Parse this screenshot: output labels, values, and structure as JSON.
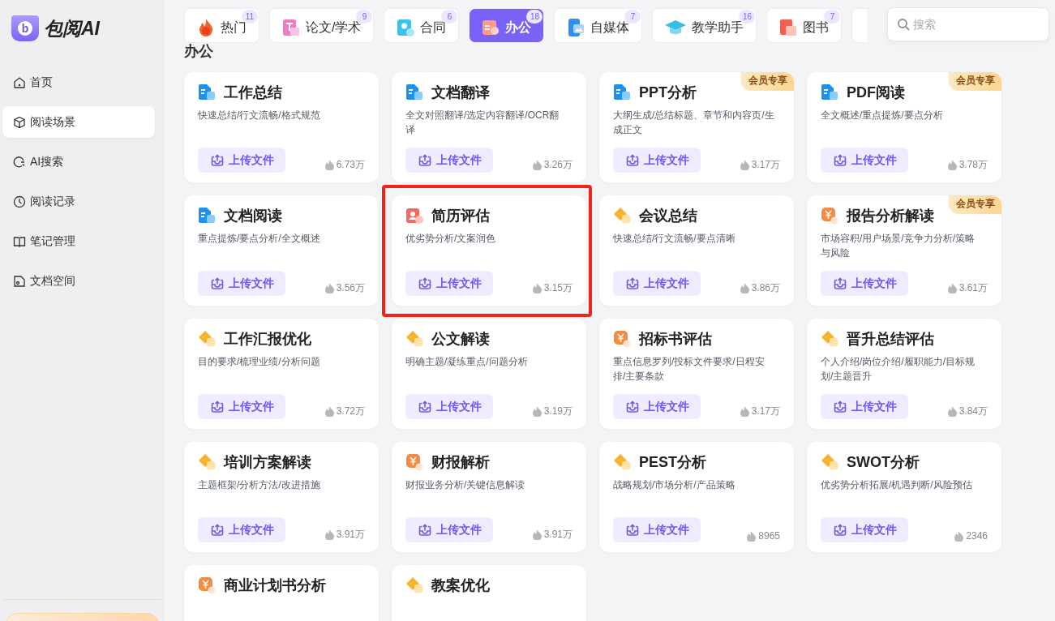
{
  "logo": {
    "mark": "b",
    "text": "包阅AI"
  },
  "sidebar": {
    "items": [
      {
        "label": "首页",
        "kind": "home",
        "selected": false
      },
      {
        "label": "阅读场景",
        "kind": "cube",
        "selected": true
      },
      {
        "label": "AI搜索",
        "kind": "search",
        "selected": false
      },
      {
        "label": "阅读记录",
        "kind": "clock",
        "selected": false
      },
      {
        "label": "笔记管理",
        "kind": "book",
        "selected": false
      },
      {
        "label": "文档空间",
        "kind": "file",
        "selected": false
      }
    ]
  },
  "tabs": [
    {
      "label": "热门",
      "kind": "fire",
      "badge": "11",
      "selected": false
    },
    {
      "label": "论文/学术",
      "kind": "paper",
      "badge": "9",
      "selected": false
    },
    {
      "label": "合同",
      "kind": "contract",
      "badge": "6",
      "selected": false
    },
    {
      "label": "办公",
      "kind": "office",
      "badge": "18",
      "selected": true
    },
    {
      "label": "自媒体",
      "kind": "media",
      "badge": "7",
      "selected": false
    },
    {
      "label": "教学助手",
      "kind": "cap",
      "badge": "16",
      "selected": false
    },
    {
      "label": "图书",
      "kind": "books",
      "badge": "7",
      "selected": false
    }
  ],
  "more_tab_visible": true,
  "search": {
    "placeholder": "搜索"
  },
  "section_title": "办公",
  "cards": [
    {
      "title": "工作总结",
      "kind": "doc",
      "description": "快速总结/行文流畅/格式规范",
      "action": "上传文件",
      "count": "6.73万",
      "highlighted": false
    },
    {
      "title": "文档翻译",
      "kind": "doc",
      "description": "全文对照翻译/选定内容翻译/OCR翻译",
      "action": "上传文件",
      "count": "3.26万",
      "highlighted": false
    },
    {
      "title": "PPT分析",
      "kind": "doc",
      "description": "大纲生成/总结标题、章节和内容页/生成正文",
      "action": "上传文件",
      "count": "3.17万",
      "member_badge": "会员专享",
      "highlighted": false
    },
    {
      "title": "PDF阅读",
      "kind": "doc",
      "description": "全文概述/重点提炼/要点分析",
      "action": "上传文件",
      "count": "3.78万",
      "member_badge": "会员专享",
      "highlighted": false
    },
    {
      "title": "文档阅读",
      "kind": "doc",
      "description": "重点提炼/要点分析/全文概述",
      "action": "上传文件",
      "count": "3.56万",
      "highlighted": false
    },
    {
      "title": "简历评估",
      "kind": "person",
      "description": "优劣势分析/文案润色",
      "action": "上传文件",
      "count": "3.15万",
      "highlighted": true
    },
    {
      "title": "会议总结",
      "kind": "diamond",
      "description": "快速总结/行文流畅/要点清晰",
      "action": "上传文件",
      "count": "3.86万",
      "highlighted": false
    },
    {
      "title": "报告分析解读",
      "kind": "yen",
      "description": "市场容积/用户场景/竞争力分析/策略与风险",
      "action": "上传文件",
      "count": "3.61万",
      "member_badge": "会员专享",
      "highlighted": false
    },
    {
      "title": "工作汇报优化",
      "kind": "diamond",
      "description": "目的要求/梳理业绩/分析问题",
      "action": "上传文件",
      "count": "3.72万",
      "highlighted": false
    },
    {
      "title": "公文解读",
      "kind": "diamond",
      "description": "明确主题/凝练重点/问题分析",
      "action": "上传文件",
      "count": "3.19万",
      "highlighted": false
    },
    {
      "title": "招标书评估",
      "kind": "yen",
      "description": "重点信息罗列/投标文件要求/日程安排/主要条款",
      "action": "上传文件",
      "count": "3.17万",
      "highlighted": false
    },
    {
      "title": "晋升总结评估",
      "kind": "diamond",
      "description": "个人介绍/岗位介绍/履职能力/目标规划/主题晋升",
      "action": "上传文件",
      "count": "3.84万",
      "highlighted": false
    },
    {
      "title": "培训方案解读",
      "kind": "diamond",
      "description": "主题框架/分析方法/改进措施",
      "action": "上传文件",
      "count": "3.91万",
      "highlighted": false
    },
    {
      "title": "财报解析",
      "kind": "yen",
      "description": "财报业务分析/关键信息解读",
      "action": "上传文件",
      "count": "3.91万",
      "highlighted": false
    },
    {
      "title": "PEST分析",
      "kind": "diamond",
      "description": "战略规划/市场分析/产品策略",
      "action": "上传文件",
      "count": "8965",
      "highlighted": false
    },
    {
      "title": "SWOT分析",
      "kind": "diamond",
      "description": "优劣势分析拓展/机遇判断/风险预估",
      "action": "上传文件",
      "count": "2346",
      "highlighted": false
    },
    {
      "title": "商业计划书分析",
      "kind": "yen",
      "highlighted": false
    },
    {
      "title": "教案优化",
      "kind": "diamond",
      "highlighted": false
    }
  ]
}
